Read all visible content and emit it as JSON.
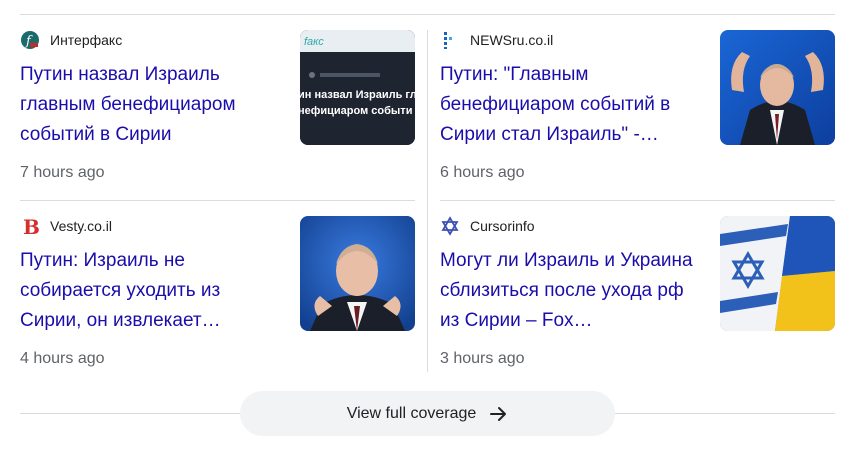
{
  "articles": [
    {
      "source": "Интерфакс",
      "source_icon": "interfax-logo-icon",
      "title": "Путин назвал Израиль главным бенефициаром событий в Сирии",
      "time": "7 hours ago",
      "thumb_caption": "Путин назвал Израиль главным бенефициаром событий"
    },
    {
      "source": "NEWSru.co.il",
      "source_icon": "newsru-logo-icon",
      "title": "Путин: \"Главным бенефициаром событий в Сирии стал Израиль\" -…",
      "time": "6 hours ago"
    },
    {
      "source": "Vesty.co.il",
      "source_icon": "vesty-logo-icon",
      "title": "Путин: Израиль не собирается уходить из Сирии, он извлекает…",
      "time": "4 hours ago"
    },
    {
      "source": "Cursorinfo",
      "source_icon": "cursorinfo-star-icon",
      "title": "Могут ли Израиль и Украина сблизиться после ухода рф из Сирии – Fox…",
      "time": "3 hours ago"
    }
  ],
  "coverage": {
    "label": "View full coverage",
    "icon": "arrow-right-icon"
  },
  "colors": {
    "link": "#1a0dab",
    "meta": "#5f6368",
    "divider": "#dadce0",
    "button_bg": "#f1f3f4"
  }
}
